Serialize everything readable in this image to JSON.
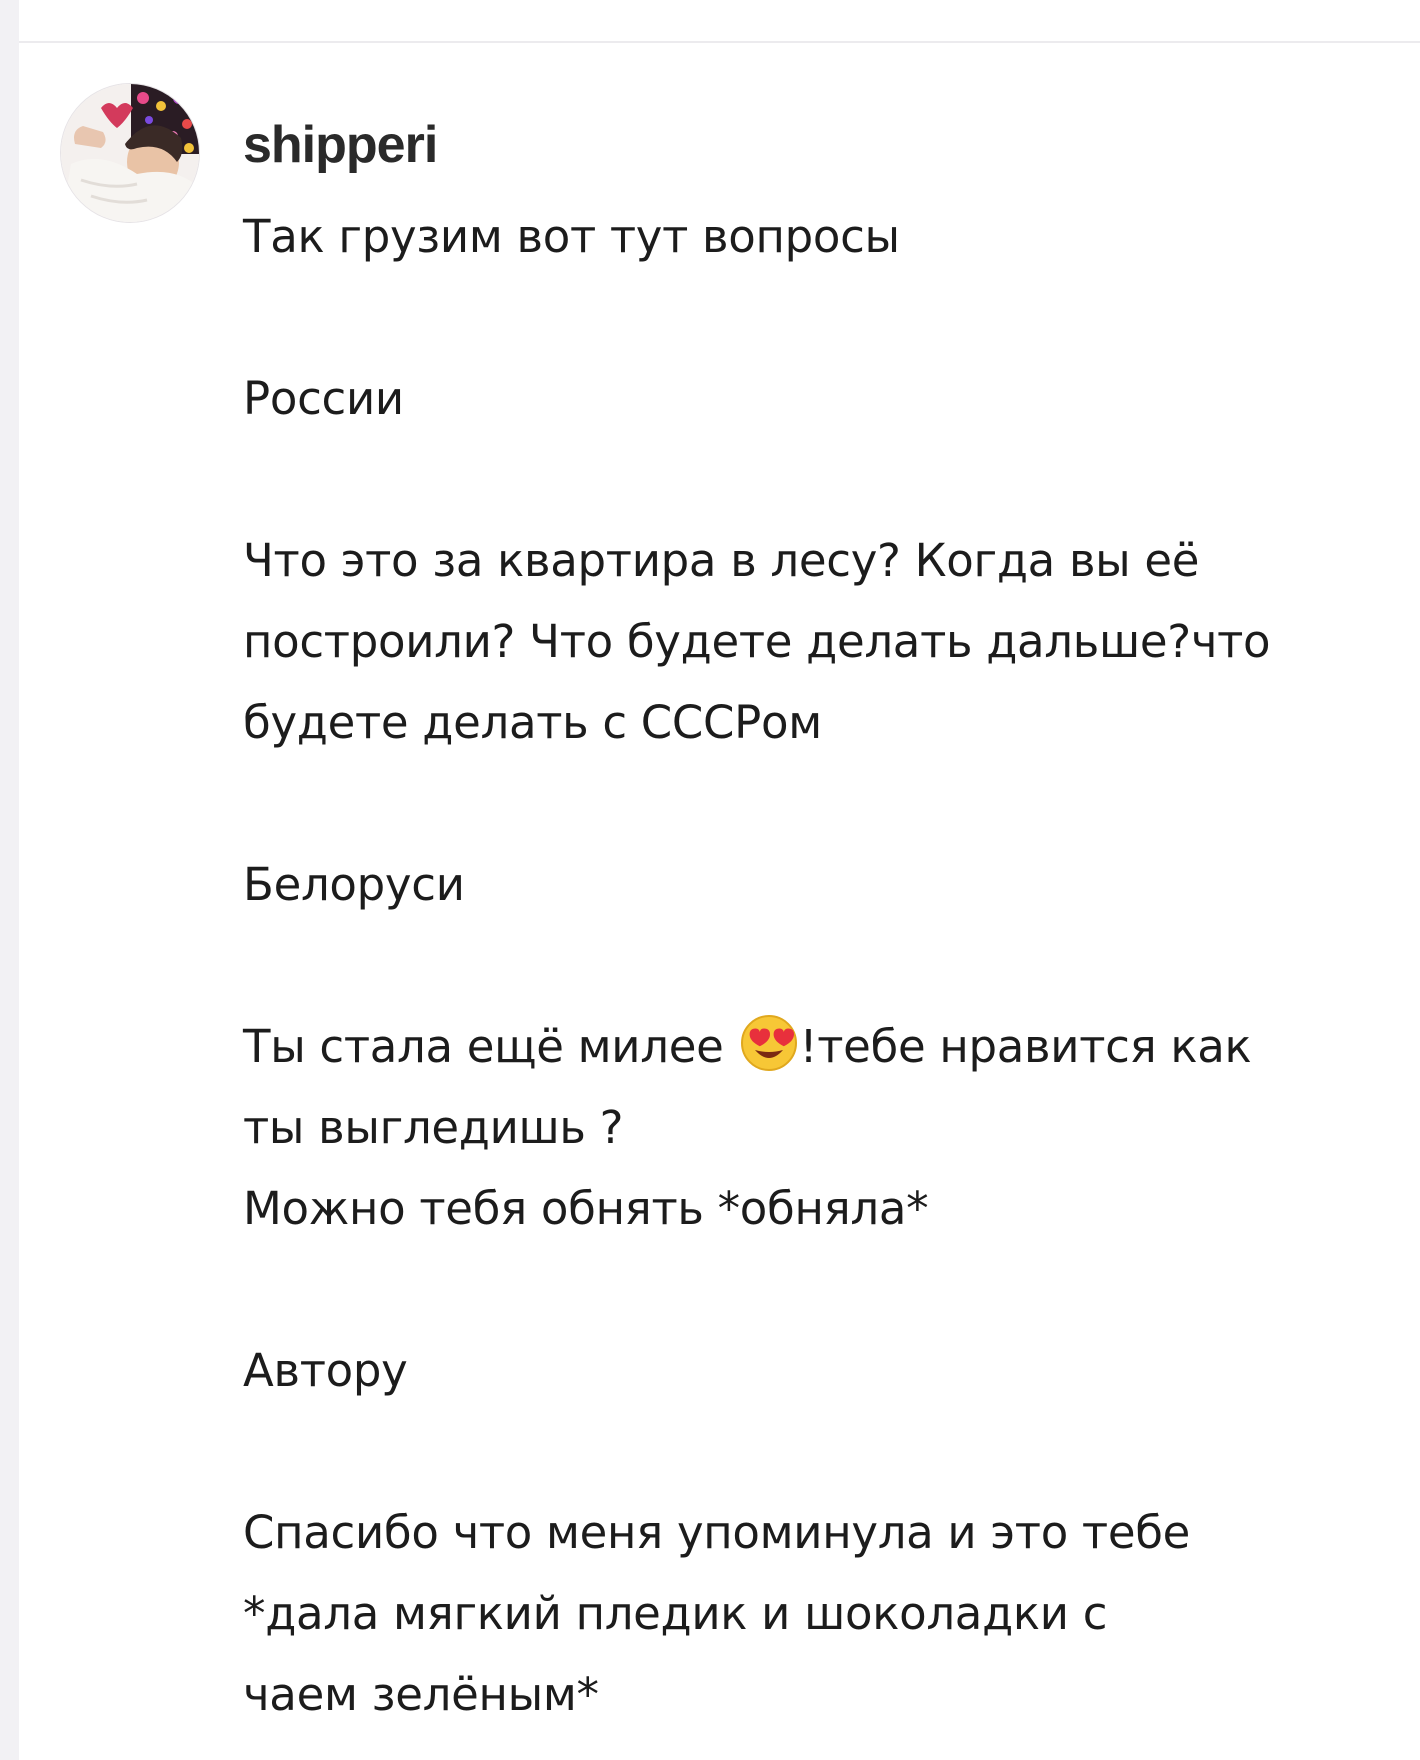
{
  "comment": {
    "author": "shipperi",
    "lines": [
      "Так грузим вот тут вопросы",
      "",
      "России",
      "",
      "Что это за квартира в лесу? Когда вы её",
      "построили? Что будете делать дальше?что",
      "будете делать с СССРом",
      "",
      "Белоруси",
      "",
      "Ты стала ещё милее",
      "!тебе нравится как",
      "ты выгледишь ?",
      "Можно тебя обнять *обняла*",
      "",
      "Автору",
      "",
      "Спасибо что меня упоминула и это тебе",
      "*дала мягкий пледик и шоколадки с",
      "чаем зелёным*"
    ],
    "emoji": "heart-eyes-emoji"
  },
  "colors": {
    "page_background": "#ffffff",
    "side_strip": "#f2f1f4",
    "text": "#1c1c1c",
    "author_text": "#2a2a2a"
  }
}
